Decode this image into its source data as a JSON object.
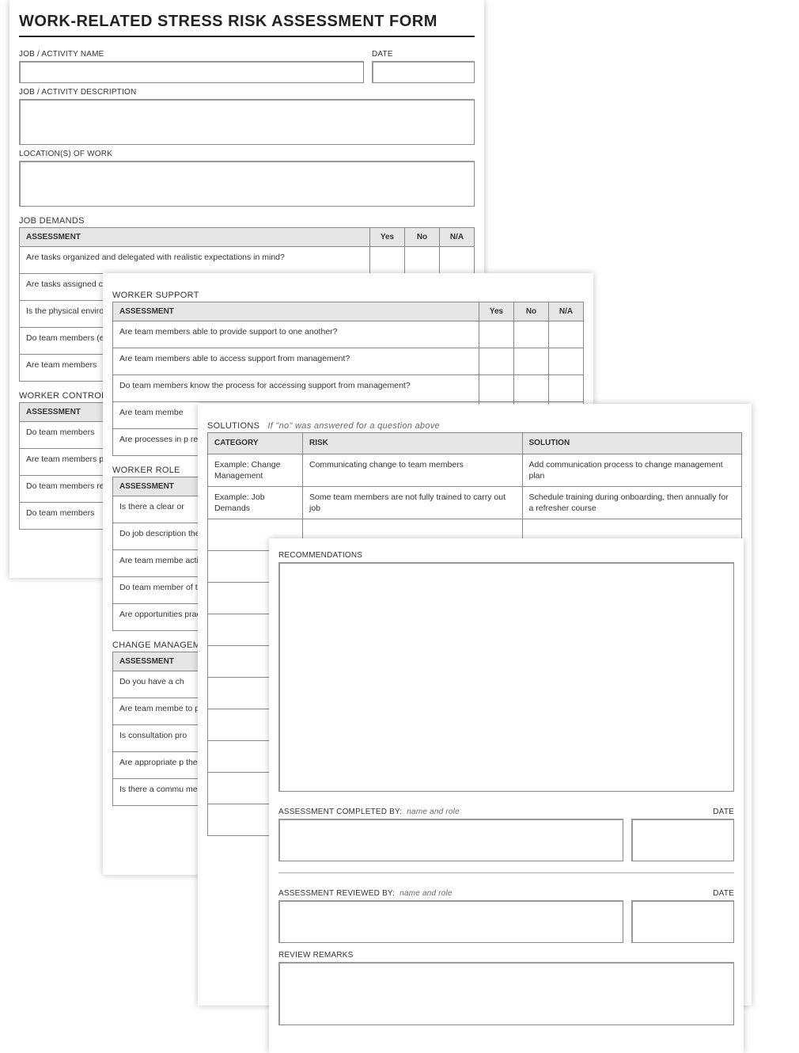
{
  "form_title": "WORK-RELATED STRESS RISK ASSESSMENT FORM",
  "labels": {
    "job_name": "JOB / ACTIVITY NAME",
    "date": "DATE",
    "job_desc": "JOB / ACTIVITY DESCRIPTION",
    "locations": "LOCATION(S) OF WORK",
    "recommendations": "RECOMMENDATIONS",
    "completed_by": "ASSESSMENT COMPLETED BY:",
    "reviewed_by": "ASSESSMENT REVIEWED BY:",
    "name_role_hint": "name and role",
    "review_remarks": "REVIEW REMARKS"
  },
  "yn_headers": {
    "assessment": "ASSESSMENT",
    "yes": "Yes",
    "no": "No",
    "na": "N/A"
  },
  "sections": {
    "job_demands": {
      "title": "JOB DEMANDS",
      "items": [
        "Are tasks organized and delegated with realistic expectations in mind?",
        "Are tasks assigned c",
        "Is the physical environment (e.g. comfortable, s",
        "Do team members (e.g. equipment, tra",
        "Are team members"
      ]
    },
    "worker_control": {
      "title": "WORKER CONTROL",
      "items": [
        "Do team members",
        "Are team members professionally deve",
        "Do team members regarding work?",
        "Do team members"
      ]
    },
    "worker_support": {
      "title": "WORKER SUPPORT",
      "items": [
        "Are team members able to provide support to one another?",
        "Are team members able to access support from management?",
        "Do team members know the process for accessing support from management?",
        "Are team membe",
        "Are processes in p related issues?"
      ]
    },
    "worker_role": {
      "title": "WORKER ROLE",
      "items": [
        "Is there a clear or",
        "Do job description the role?",
        "Are team membe activities?",
        "Do team member of the organizatio",
        "Are opportunities practices related"
      ]
    },
    "change_mgmt": {
      "title": "CHANGE MANAGEMENT",
      "items": [
        "Do you have a ch",
        "Are team membe to potential chan",
        "Is consultation pro",
        "Are appropriate p the change proce",
        "Is there a commu members?"
      ]
    }
  },
  "solutions": {
    "title": "SOLUTIONS",
    "hint": "If \"no\" was answered for a question above",
    "headers": {
      "category": "CATEGORY",
      "risk": "RISK",
      "solution": "SOLUTION"
    },
    "rows": [
      {
        "category": "Example: Change Management",
        "risk": "Communicating change to team members",
        "solution": "Add communication process to change management plan"
      },
      {
        "category": "Example: Job Demands",
        "risk": "Some team members are not fully trained to carry out job",
        "solution": "Schedule training during onboarding, then annually for a refresher course"
      }
    ],
    "empty_rows": 10
  }
}
